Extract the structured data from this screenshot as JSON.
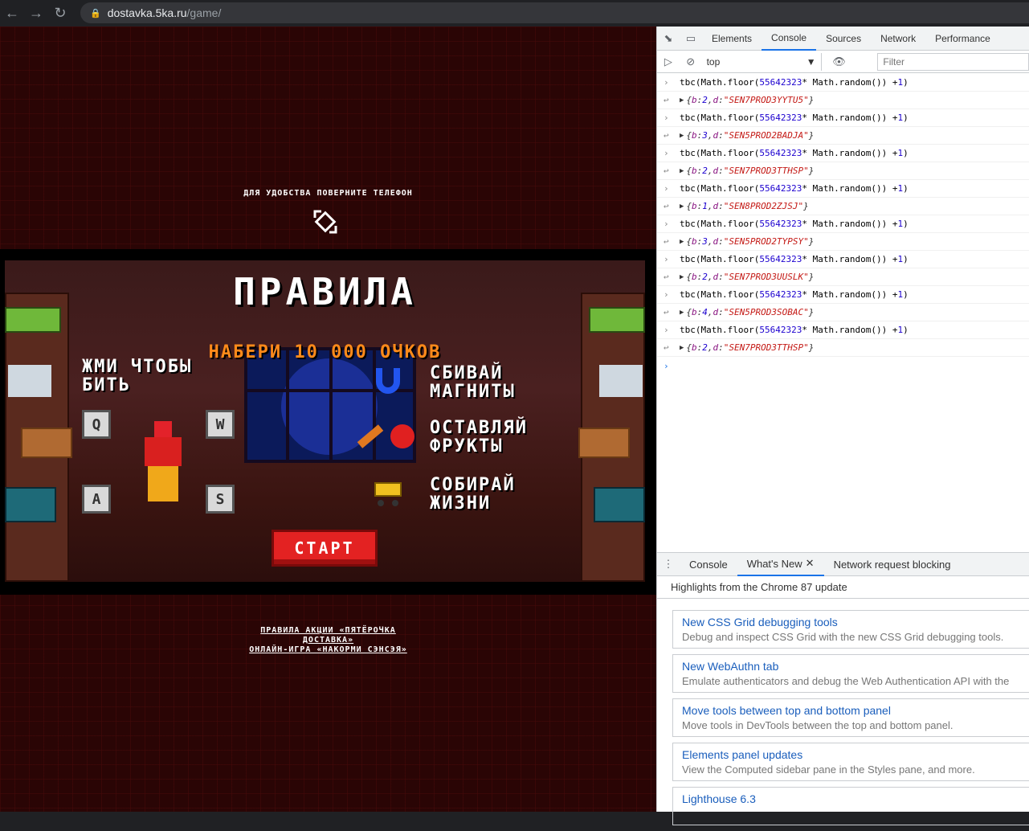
{
  "browser": {
    "url_host": "dostavka.5ka.ru",
    "url_path": "/game/"
  },
  "game": {
    "rotate_hint": "ДЛЯ УДОБСТВА ПОВЕРНИТЕ ТЕЛЕФОН",
    "title": "ПРАВИЛА",
    "subtitle": "НАБЕРИ 10 000 ОЧКОВ",
    "rule_hit_line1": "ЖМИ ЧТОБЫ",
    "rule_hit_line2": "БИТЬ",
    "keys": [
      "Q",
      "W",
      "A",
      "S"
    ],
    "rule_magnets_line1": "СБИВАЙ",
    "rule_magnets_line2": "МАГНИТЫ",
    "rule_fruits_line1": "ОСТАВЛЯЙ",
    "rule_fruits_line2": "ФРУКТЫ",
    "rule_lives_line1": "СОБИРАЙ",
    "rule_lives_line2": "ЖИЗНИ",
    "start_label": "СТАРТ",
    "footer_link1_line1": "ПРАВИЛА АКЦИИ «ПЯТЁРОЧКА",
    "footer_link1_line2": "ДОСТАВКА»",
    "footer_link2": "ОНЛАЙН-ИГРА «НАКОРМИ СЭНСЭЯ»"
  },
  "devtools": {
    "tabs": [
      "Elements",
      "Console",
      "Sources",
      "Network",
      "Performance"
    ],
    "active_tab": "Console",
    "context": "top",
    "filter_placeholder": "Filter",
    "console": [
      {
        "b": "2",
        "d": "\"SEN7PROD3YYTU5\""
      },
      {
        "b": "3",
        "d": "\"SEN5PROD2BADJA\""
      },
      {
        "b": "2",
        "d": "\"SEN7PROD3TTHSP\""
      },
      {
        "b": "1",
        "d": "\"SEN8PROD2ZJSJ\""
      },
      {
        "b": "3",
        "d": "\"SEN5PROD2TYPSY\""
      },
      {
        "b": "2",
        "d": "\"SEN7PROD3UUSLK\""
      },
      {
        "b": "4",
        "d": "\"SEN5PROD3SOBAC\""
      },
      {
        "b": "2",
        "d": "\"SEN7PROD3TTHSP\""
      }
    ],
    "command_fn": "tbc(Math.floor(",
    "command_num": "55642323",
    "command_mid": " * Math.random()) + ",
    "command_one": "1",
    "command_end": ")",
    "drawer_tabs": [
      "Console",
      "What's New",
      "Network request blocking"
    ],
    "whats_new_heading": "Highlights from the Chrome 87 update",
    "cards": [
      {
        "title": "New CSS Grid debugging tools",
        "desc": "Debug and inspect CSS Grid with the new CSS Grid debugging tools."
      },
      {
        "title": "New WebAuthn tab",
        "desc": "Emulate authenticators and debug the Web Authentication API with the"
      },
      {
        "title": "Move tools between top and bottom panel",
        "desc": "Move tools in DevTools between the top and bottom panel."
      },
      {
        "title": "Elements panel updates",
        "desc": "View the Computed sidebar pane in the Styles pane, and more."
      },
      {
        "title": "Lighthouse 6.3",
        "desc": ""
      }
    ]
  }
}
